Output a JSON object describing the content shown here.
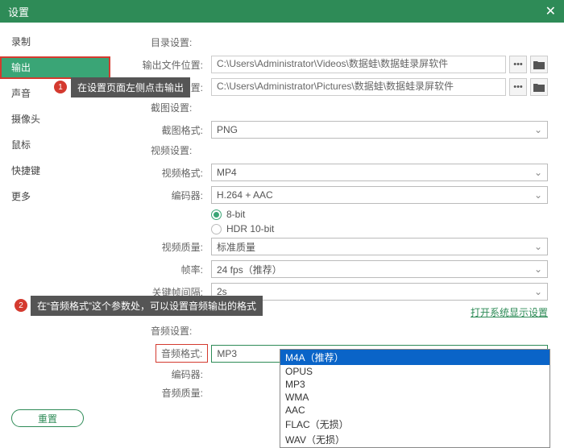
{
  "title": "设置",
  "sidebar": {
    "items": [
      "录制",
      "输出",
      "声音",
      "摄像头",
      "鼠标",
      "快捷键",
      "更多"
    ],
    "active_index": 1
  },
  "callouts": {
    "c1_badge": "1",
    "c1_text": "在设置页面左侧点击输出",
    "c2_badge": "2",
    "c2_text": "在“音频格式”这个参数处，可以设置音频输出的格式"
  },
  "sections": {
    "dir": "目录设置:",
    "screenshot": "截图设置:",
    "video": "视频设置:",
    "audio": "音频设置:"
  },
  "labels": {
    "output_path": "输出文件位置:",
    "screenshot_path": "截图文件位置:",
    "screenshot_format": "截图格式:",
    "video_format": "视频格式:",
    "encoder": "编码器:",
    "video_quality": "视频质量:",
    "fps": "帧率:",
    "keyframe": "关键帧间隔:",
    "audio_format": "音频格式:",
    "audio_encoder": "编码器:",
    "audio_quality": "音频质量:"
  },
  "values": {
    "output_path": "C:\\Users\\Administrator\\Videos\\数据蛙\\数据蛙录屏软件",
    "screenshot_path": "C:\\Users\\Administrator\\Pictures\\数据蛙\\数据蛙录屏软件",
    "screenshot_format": "PNG",
    "video_format": "MP4",
    "encoder": "H.264 + AAC",
    "bit8": "8-bit",
    "hdr10": "HDR 10-bit",
    "video_quality": "标准质量",
    "fps": "24 fps（推荐）",
    "keyframe": "2s",
    "audio_format": "MP3",
    "audio_encoder": "",
    "audio_quality": ""
  },
  "dropdown_options": [
    "M4A（推荐）",
    "OPUS",
    "MP3",
    "WMA",
    "AAC",
    "FLAC（无损）",
    "WAV（无损）"
  ],
  "link": "打开系统显示设置",
  "reset": "重置",
  "ellipsis": "•••"
}
